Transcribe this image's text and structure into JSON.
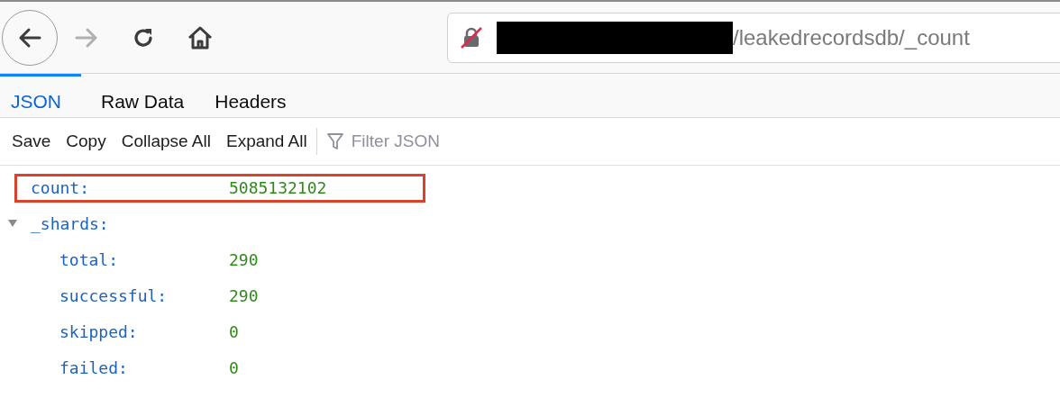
{
  "navigation": {
    "back": {
      "disabled": false
    },
    "forward": {
      "disabled": true
    }
  },
  "address_bar": {
    "insecure": true,
    "redacted": true,
    "url": "/leakedrecordsdb/_count"
  },
  "tabs": [
    {
      "label": "JSON",
      "selected": true
    },
    {
      "label": "Raw Data",
      "selected": false
    },
    {
      "label": "Headers",
      "selected": false
    }
  ],
  "toolbar": {
    "buttons": [
      "Save",
      "Copy",
      "Collapse All",
      "Expand All"
    ],
    "filter": {
      "placeholder": "Filter JSON"
    }
  },
  "tree": [
    {
      "key": "count:",
      "value": "5085132102",
      "highlighted": true
    },
    {
      "key": "_shards:",
      "expanded": true,
      "children": [
        {
          "key": "total:",
          "value": "290"
        },
        {
          "key": "successful:",
          "value": "290"
        },
        {
          "key": "skipped:",
          "value": "0"
        },
        {
          "key": "failed:",
          "value": "0"
        }
      ]
    }
  ]
}
